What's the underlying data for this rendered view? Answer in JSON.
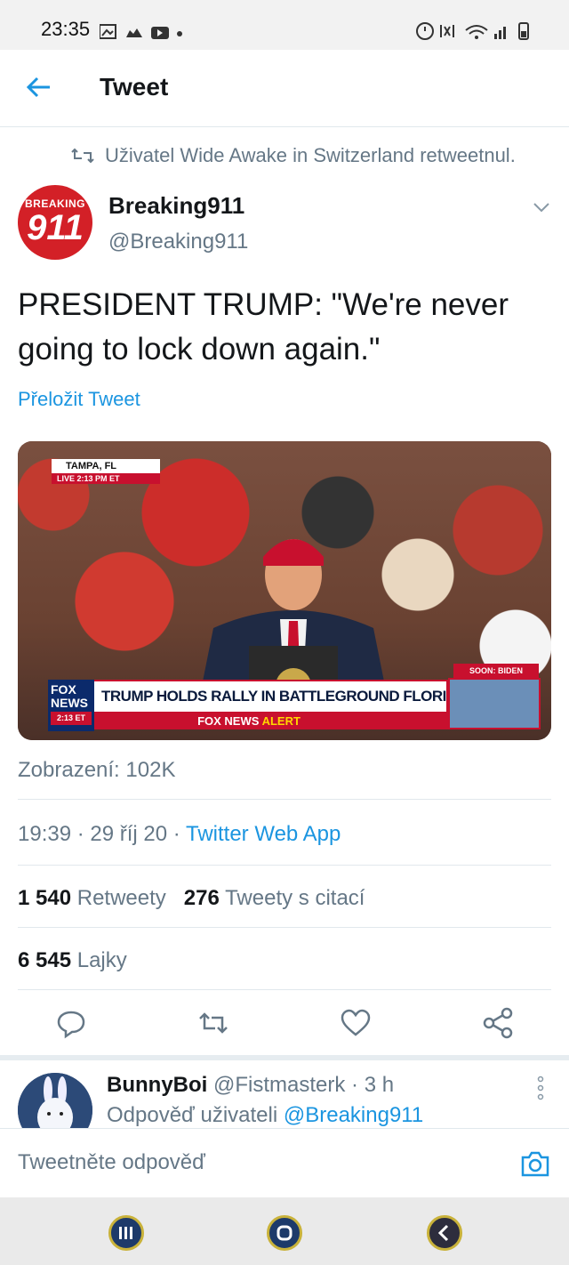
{
  "status_bar": {
    "time": "23:35"
  },
  "header": {
    "title": "Tweet"
  },
  "tweet": {
    "retweeted_by": "Uživatel Wide Awake in Switzerland retweetnul.",
    "author_name": "Breaking911",
    "author_handle": "@Breaking911",
    "avatar_text_top": "BREAKING",
    "avatar_text_main": "911",
    "text": "PRESIDENT TRUMP: \"We're never going to lock down again.\"",
    "translate_label": "Přeložit Tweet",
    "media": {
      "location": "TAMPA, FL",
      "live_label": "LIVE 2:13 PM ET",
      "soon_label": "SOON: BIDEN SPEAKS",
      "headline": "TRUMP HOLDS RALLY IN BATTLEGROUND FLORIDA",
      "alert_part1": "FOX NEWS",
      "alert_part2": "ALERT",
      "logo_text": "FOX NEWS",
      "logo_time": "2:13 ET"
    },
    "views": "Zobrazení: 102K",
    "time": "19:39 · 29 říj 20 · ",
    "source": "Twitter Web App",
    "retweets_count": "1 540",
    "retweets_label": "Retweety",
    "quotes_count": "276",
    "quotes_label": "Tweety s citací",
    "likes_count": "6 545",
    "likes_label": "Lajky"
  },
  "reply": {
    "name": "BunnyBoi",
    "meta": "@Fistmasterk · 3 h",
    "reply_prefix": "Odpověď uživateli",
    "reply_to": "@Breaking911"
  },
  "composer": {
    "placeholder": "Tweetněte odpověď"
  },
  "colors": {
    "accent": "#1b95e0",
    "text": "#14171a",
    "muted": "#657786",
    "brand_red": "#d32027"
  },
  "icons": [
    "back-arrow-icon",
    "retweet-icon",
    "chevron-down-icon",
    "reply-icon",
    "retweet-icon",
    "like-icon",
    "share-icon",
    "more-icon",
    "camera-icon"
  ]
}
